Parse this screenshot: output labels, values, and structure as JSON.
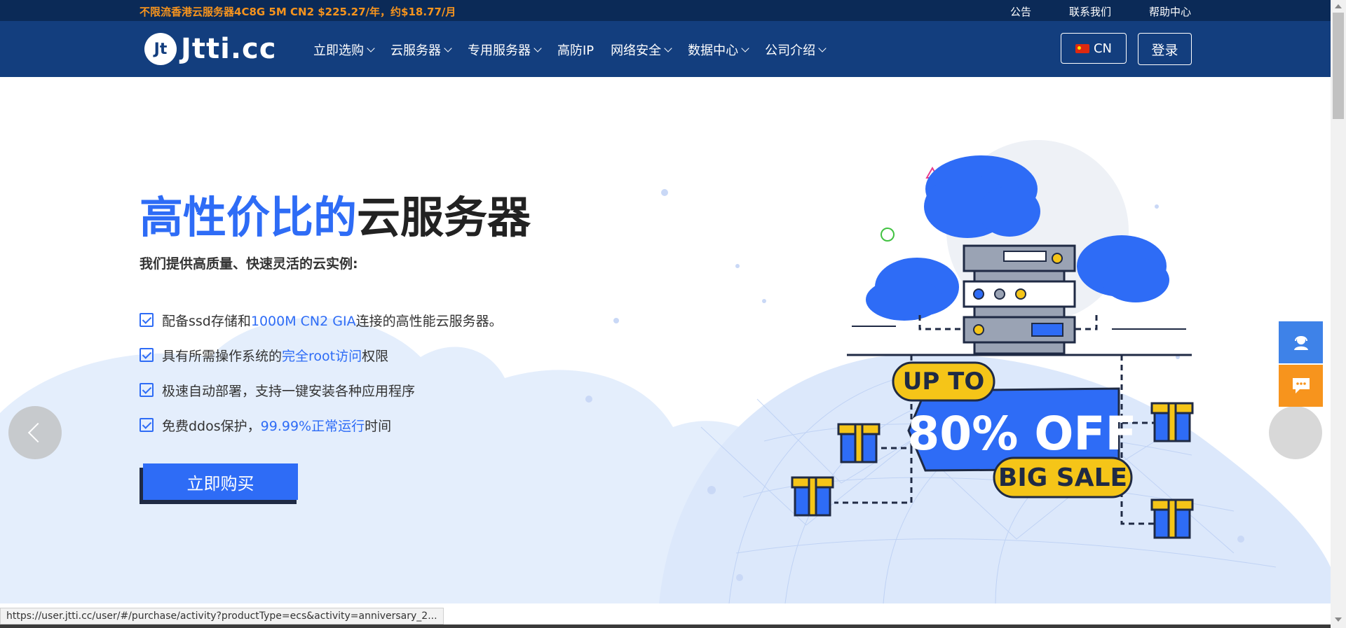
{
  "topbar": {
    "promo": "不限流香港云服务器4C8G 5M CN2 $225.27/年，约$18.77/月",
    "links": [
      "公告",
      "联系我们",
      "帮助中心"
    ]
  },
  "nav": {
    "logo_mark": "Jt",
    "logo_text": "Jtti.cc",
    "menu": [
      {
        "label": "立即选购",
        "dropdown": true
      },
      {
        "label": "云服务器",
        "dropdown": true
      },
      {
        "label": "专用服务器",
        "dropdown": true
      },
      {
        "label": "高防IP",
        "dropdown": false
      },
      {
        "label": "网络安全",
        "dropdown": true
      },
      {
        "label": "数据中心",
        "dropdown": true
      },
      {
        "label": "公司介绍",
        "dropdown": true
      }
    ],
    "lang": "CN",
    "login": "登录"
  },
  "hero": {
    "title_blue": "高性价比的",
    "title_dark": "云服务器",
    "subtitle": "我们提供高质量、快速灵活的云实例:",
    "features": [
      {
        "pre": "配备ssd存储和",
        "hl": "1000M CN2 GIA",
        "post": "连接的高性能云服务器。"
      },
      {
        "pre": "具有所需操作系统的",
        "hl": "完全root访问",
        "post": "权限"
      },
      {
        "pre": "极速自动部署，支持一键安装各种应用程序",
        "hl": "",
        "post": ""
      },
      {
        "pre": "免费ddos保护，",
        "hl": "99.99%正常运行",
        "post": "时间"
      }
    ],
    "buy_button": "立即购买",
    "badge_up_to": "UP TO",
    "badge_off": "80% OFF",
    "badge_sale": "BIG SALE"
  },
  "statusbar": {
    "url": "https://user.jtti.cc/user/#/purchase/activity?productType=ecs&activity=anniversary_2..."
  },
  "colors": {
    "topbar": "#0b2a57",
    "nav": "#133e7e",
    "accent": "#2e6cf6",
    "promo": "#f7941d",
    "badge_yellow": "#f5c518"
  }
}
